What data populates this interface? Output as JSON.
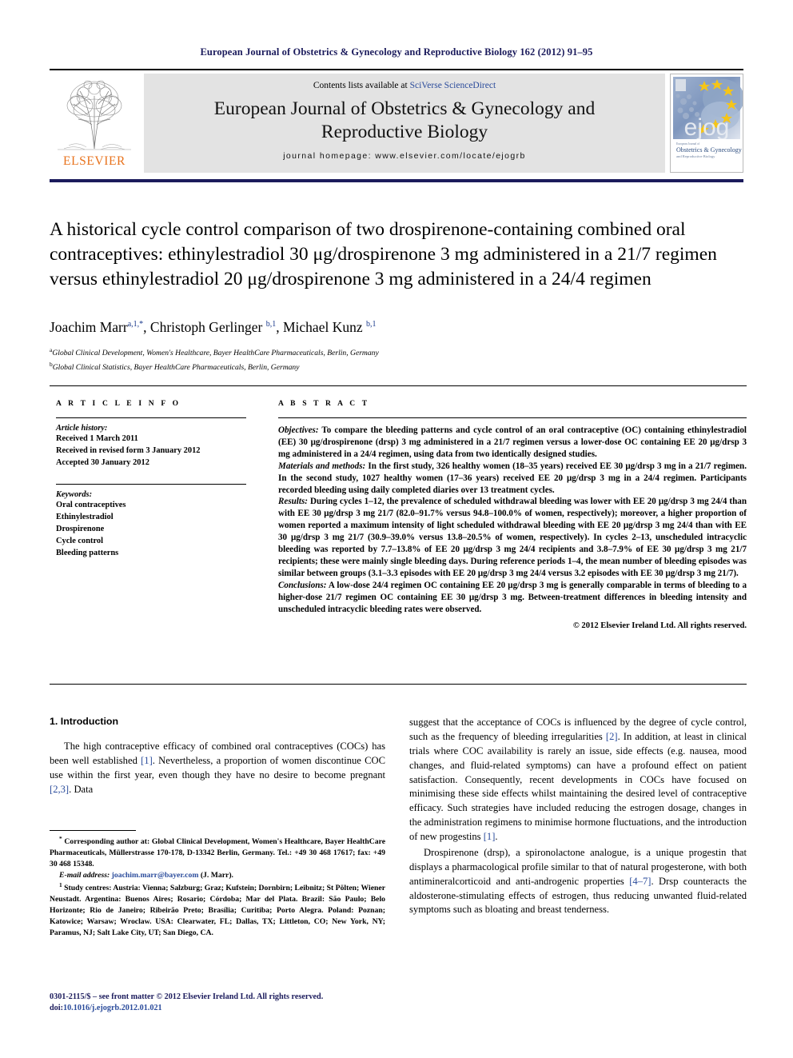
{
  "running_head": "European Journal of Obstetrics & Gynecology and Reproductive Biology 162 (2012) 91–95",
  "masthead": {
    "contents_prefix": "Contents lists available at ",
    "contents_link": "SciVerse ScienceDirect",
    "journal_title_line1": "European Journal of Obstetrics & Gynecology and",
    "journal_title_line2": "Reproductive Biology",
    "homepage": "journal homepage: www.elsevier.com/locate/ejogrb",
    "publisher_wordmark": "ELSEVIER",
    "cover_wordmark": "ejog",
    "cover_subtitle_line1": "Obstetrics & Gynecology",
    "cover_subtitle_line2": "and Reproductive Biology",
    "cover_kicker": "European Journal of"
  },
  "article": {
    "title": "A historical cycle control comparison of two drospirenone-containing combined oral contraceptives: ethinylestradiol 30 μg/drospirenone 3 mg administered in a 21/7 regimen versus ethinylestradiol 20 μg/drospirenone 3 mg administered in a 24/4 regimen",
    "authors": [
      {
        "name": "Joachim Marr",
        "sup": "a,1,*"
      },
      {
        "name": "Christoph Gerlinger",
        "sup": "b,1"
      },
      {
        "name": "Michael Kunz",
        "sup": "b,1"
      }
    ],
    "affiliations": [
      {
        "marker": "a",
        "text": "Global Clinical Development, Women's Healthcare, Bayer HealthCare Pharmaceuticals, Berlin, Germany"
      },
      {
        "marker": "b",
        "text": "Global Clinical Statistics, Bayer HealthCare Pharmaceuticals, Berlin, Germany"
      }
    ]
  },
  "article_info": {
    "heading": "A R T I C L E   I N F O",
    "history_label": "Article history:",
    "history": [
      "Received 1 March 2011",
      "Received in revised form 3 January 2012",
      "Accepted 30 January 2012"
    ],
    "keywords_label": "Keywords:",
    "keywords": [
      "Oral contraceptives",
      "Ethinylestradiol",
      "Drospirenone",
      "Cycle control",
      "Bleeding patterns"
    ]
  },
  "abstract": {
    "heading": "A B S T R A C T",
    "sections": [
      {
        "label": "Objectives:",
        "text": " To compare the bleeding patterns and cycle control of an oral contraceptive (OC) containing ethinylestradiol (EE) 30 μg/drospirenone (drsp) 3 mg administered in a 21/7 regimen versus a lower-dose OC containing EE 20 μg/drsp 3 mg administered in a 24/4 regimen, using data from two identically designed studies."
      },
      {
        "label": "Materials and methods:",
        "text": " In the first study, 326 healthy women (18–35 years) received EE 30 μg/drsp 3 mg in a 21/7 regimen. In the second study, 1027 healthy women (17–36 years) received EE 20 μg/drsp 3 mg in a 24/4 regimen. Participants recorded bleeding using daily completed diaries over 13 treatment cycles."
      },
      {
        "label": "Results:",
        "text": " During cycles 1–12, the prevalence of scheduled withdrawal bleeding was lower with EE 20 μg/drsp 3 mg 24/4 than with EE 30 μg/drsp 3 mg 21/7 (82.0–91.7% versus 94.8–100.0% of women, respectively); moreover, a higher proportion of women reported a maximum intensity of light scheduled withdrawal bleeding with EE 20 μg/drsp 3 mg 24/4 than with EE 30 μg/drsp 3 mg 21/7 (30.9–39.0% versus 13.8–20.5% of women, respectively). In cycles 2–13, unscheduled intracyclic bleeding was reported by 7.7–13.8% of EE 20 μg/drsp 3 mg 24/4 recipients and 3.8–7.9% of EE 30 μg/drsp 3 mg 21/7 recipients; these were mainly single bleeding days. During reference periods 1–4, the mean number of bleeding episodes was similar between groups (3.1–3.3 episodes with EE 20 μg/drsp 3 mg 24/4 versus 3.2 episodes with EE 30 μg/drsp 3 mg 21/7)."
      },
      {
        "label": "Conclusions:",
        "text": " A low-dose 24/4 regimen OC containing EE 20 μg/drsp 3 mg is generally comparable in terms of bleeding to a higher-dose 21/7 regimen OC containing EE 30 μg/drsp 3 mg. Between-treatment differences in bleeding intensity and unscheduled intracyclic bleeding rates were observed."
      }
    ],
    "copyright": "© 2012 Elsevier Ireland Ltd. All rights reserved."
  },
  "body": {
    "section_heading": "1. Introduction",
    "left_paragraph_1_a": "The high contraceptive efficacy of combined oral contraceptives (COCs) has been well established ",
    "left_ref_1": "[1]",
    "left_paragraph_1_b": ". Nevertheless, a proportion of women discontinue COC use within the first year, even though they have no desire to become pregnant ",
    "left_ref_2": "[2,3]",
    "left_paragraph_1_c": ". Data",
    "right_paragraph_1_a": "suggest that the acceptance of COCs is influenced by the degree of cycle control, such as the frequency of bleeding irregularities ",
    "right_ref_1": "[2]",
    "right_paragraph_1_b": ". In addition, at least in clinical trials where COC availability is rarely an issue, side effects (e.g. nausea, mood changes, and fluid-related symptoms) can have a profound effect on patient satisfaction. Consequently, recent developments in COCs have focused on minimising these side effects whilst maintaining the desired level of contraceptive efficacy. Such strategies have included reducing the estrogen dosage, changes in the administration regimens to minimise hormone fluctuations, and the introduction of new progestins ",
    "right_ref_2": "[1]",
    "right_paragraph_1_c": ".",
    "right_paragraph_2_a": "Drospirenone (drsp), a spironolactone analogue, is a unique progestin that displays a pharmacological profile similar to that of natural progesterone, with both antimineralcorticoid and anti-androgenic properties ",
    "right_ref_3": "[4–7]",
    "right_paragraph_2_b": ". Drsp counteracts the aldosterone-stimulating effects of estrogen, thus reducing unwanted fluid-related symptoms such as bloating and breast tenderness."
  },
  "footnotes": {
    "corresponding_marker": "*",
    "corresponding": " Corresponding author at: Global Clinical Development, Women's Healthcare, Bayer HealthCare Pharmaceuticals, Müllerstrasse 170-178, D-13342 Berlin, Germany. Tel.: +49 30 468 17617; fax: +49 30 468 15348.",
    "email_label": "E-mail address:",
    "email": "joachim.marr@bayer.com",
    "email_suffix": " (J. Marr).",
    "study_centres_marker": "1",
    "study_centres": " Study centres: Austria: Vienna; Salzburg; Graz; Kufstein; Dornbirn; Leibnitz; St Pölten; Wiener Neustadt. Argentina: Buenos Aires; Rosario; Córdoba; Mar del Plata. Brazil: São Paulo; Belo Horizonte; Rio de Janeiro; Ribeirão Preto; Brasília; Curitiba; Porto Alegra. Poland: Poznan; Katowice; Warsaw; Wroclaw. USA: Clearwater, FL; Dallas, TX; Littleton, CO; New York, NY; Paramus, NJ; Salt Lake City, UT; San Diego, CA."
  },
  "footer": {
    "issn_line": "0301-2115/$ – see front matter © 2012 Elsevier Ireland Ltd. All rights reserved.",
    "doi_label": "doi:",
    "doi": "10.1016/j.ejogrb.2012.01.021"
  },
  "colors": {
    "header_navy": "#1b1b5c",
    "link_blue": "#2a4b9b",
    "elsevier_orange": "#e8721c",
    "masthead_gray": "#e3e3e3"
  }
}
